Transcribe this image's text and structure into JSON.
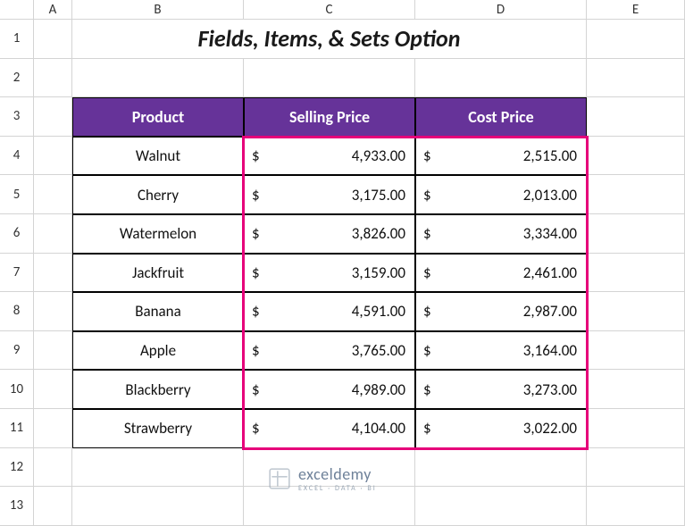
{
  "cols": [
    "A",
    "B",
    "C",
    "D",
    "E"
  ],
  "rows": [
    "1",
    "2",
    "3",
    "4",
    "5",
    "6",
    "7",
    "8",
    "9",
    "10",
    "11",
    "12",
    "13"
  ],
  "title": "Fields, Items, & Sets Option",
  "table": {
    "headers": [
      "Product",
      "Selling Price",
      "Cost Price"
    ],
    "rows": [
      {
        "product": "Walnut",
        "selling": "4,933.00",
        "cost": "2,515.00"
      },
      {
        "product": "Cherry",
        "selling": "3,175.00",
        "cost": "2,013.00"
      },
      {
        "product": "Watermelon",
        "selling": "3,826.00",
        "cost": "3,334.00"
      },
      {
        "product": "Jackfruit",
        "selling": "3,159.00",
        "cost": "2,461.00"
      },
      {
        "product": "Banana",
        "selling": "4,591.00",
        "cost": "2,987.00"
      },
      {
        "product": "Apple",
        "selling": "3,765.00",
        "cost": "3,164.00"
      },
      {
        "product": "Blackberry",
        "selling": "4,989.00",
        "cost": "3,273.00"
      },
      {
        "product": "Strawberry",
        "selling": "4,104.00",
        "cost": "3,022.00"
      }
    ]
  },
  "currency": "$",
  "watermark": {
    "name": "exceldemy",
    "tag": "EXCEL · DATA · BI"
  },
  "chart_data": {
    "type": "table",
    "title": "Fields, Items, & Sets Option",
    "columns": [
      "Product",
      "Selling Price ($)",
      "Cost Price ($)"
    ],
    "rows": [
      [
        "Walnut",
        4933.0,
        2515.0
      ],
      [
        "Cherry",
        3175.0,
        2013.0
      ],
      [
        "Watermelon",
        3826.0,
        3334.0
      ],
      [
        "Jackfruit",
        3159.0,
        2461.0
      ],
      [
        "Banana",
        4591.0,
        2987.0
      ],
      [
        "Apple",
        3765.0,
        3164.0
      ],
      [
        "Blackberry",
        4989.0,
        3273.0
      ],
      [
        "Strawberry",
        4104.0,
        3022.0
      ]
    ]
  }
}
